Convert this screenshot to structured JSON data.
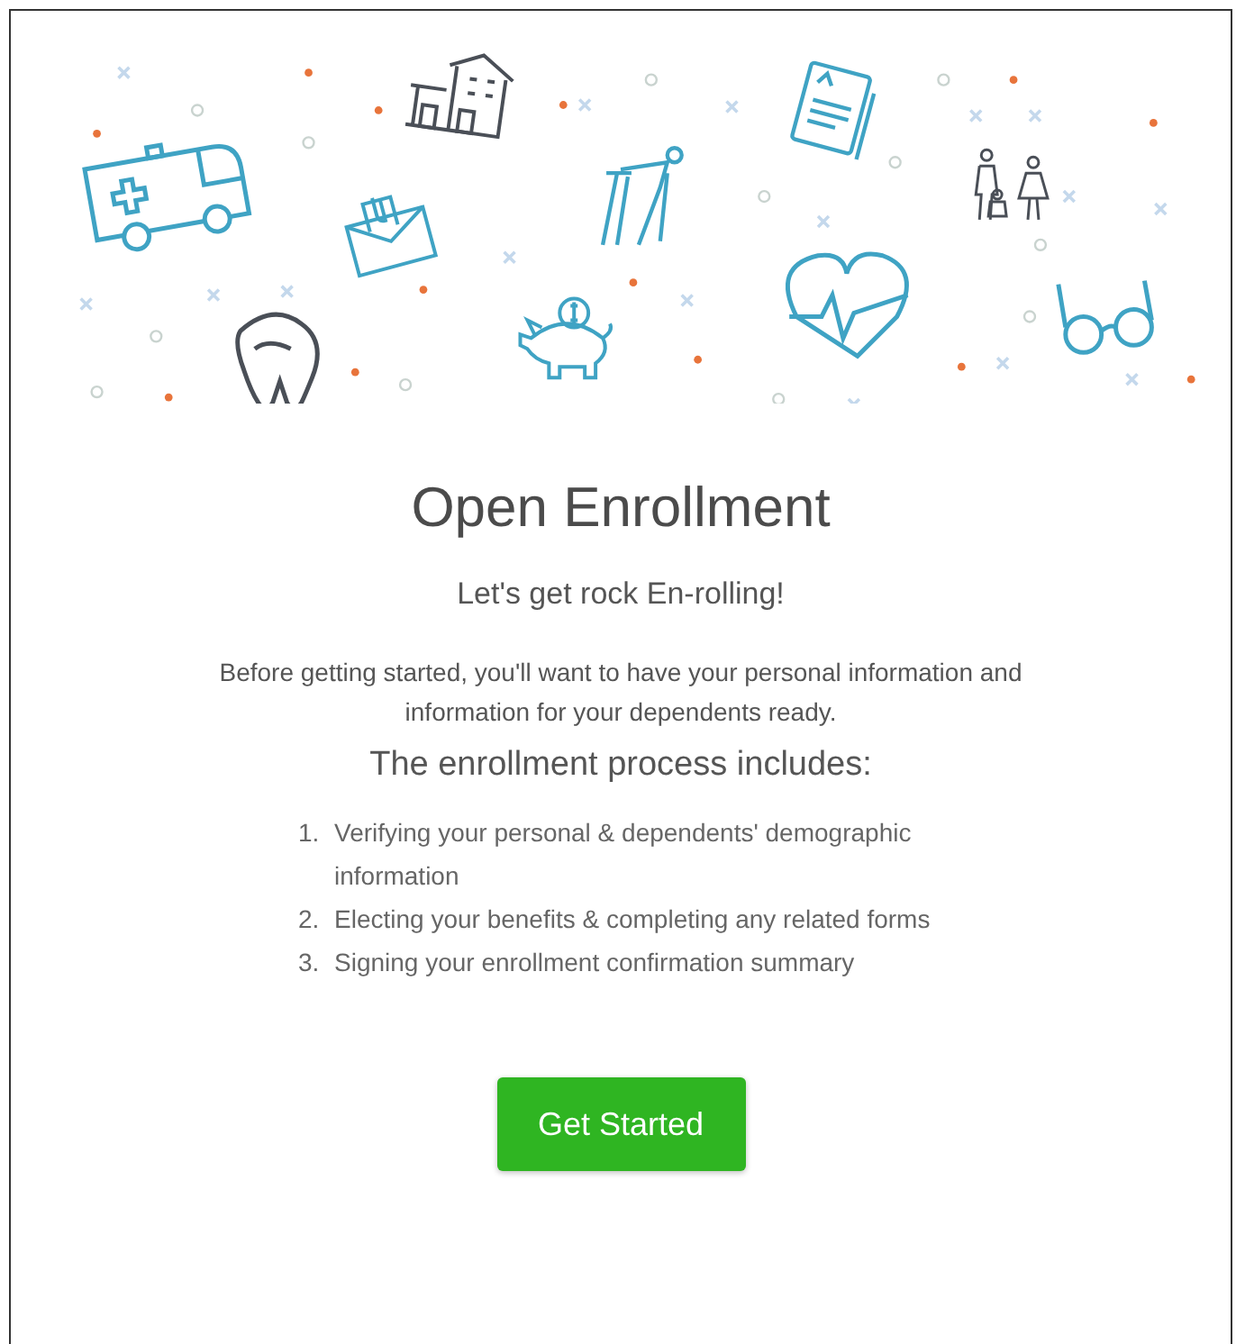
{
  "title": "Open Enrollment",
  "subtitle": "Let's get rock En-rolling!",
  "intro": "Before getting started, you'll want to have your personal information and information for your dependents ready.",
  "process_heading": "The enrollment process includes:",
  "steps": [
    {
      "number": "1.",
      "text": "Verifying your personal & dependents' demographic information"
    },
    {
      "number": "2.",
      "text": "Electing your benefits & completing any related forms"
    },
    {
      "number": "3.",
      "text": "Signing your enrollment confirmation summary"
    }
  ],
  "button": "Get Started"
}
